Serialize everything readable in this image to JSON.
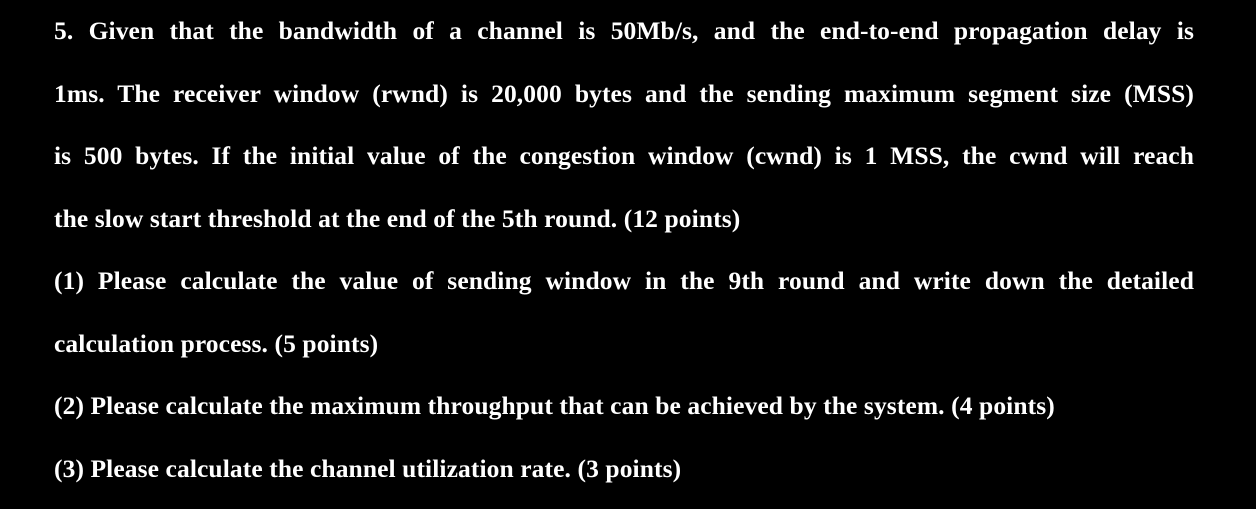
{
  "question": {
    "line_1": "5. Given that the bandwidth of a channel is 50Mb/s, and the end-to-end propagation delay is",
    "line_2": "1ms. The receiver window (rwnd) is 20,000 bytes and the sending maximum segment size (MSS)",
    "line_3": "is 500 bytes. If the initial value of the congestion window (cwnd) is 1 MSS, the cwnd will reach",
    "line_4": "the slow start threshold at the end of the 5th round. (12 points)"
  },
  "sub_questions": [
    {
      "line_1": "(1) Please calculate the value of sending window in the 9th round and write down the detailed",
      "line_2": "calculation process. (5 points)"
    },
    {
      "line_1": "(2) Please calculate the maximum throughput that can be achieved by the system. (4 points)"
    },
    {
      "line_1": "(3) Please calculate the channel utilization rate. (3 points)"
    }
  ]
}
